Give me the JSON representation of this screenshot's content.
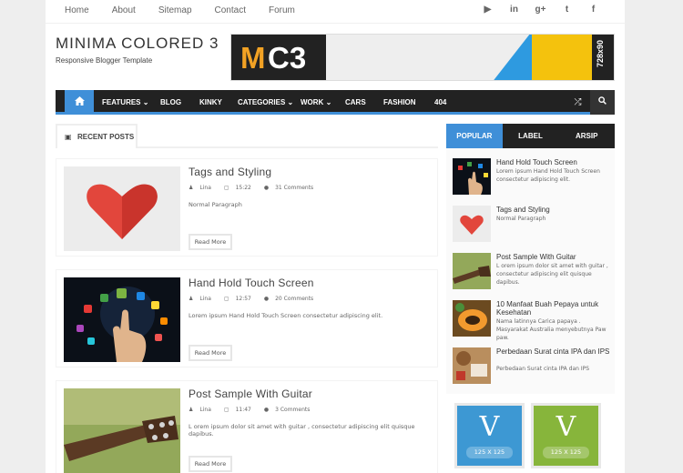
{
  "topnav": {
    "links": [
      "Home",
      "About",
      "Sitemap",
      "Contact",
      "Forum"
    ]
  },
  "social": {
    "icons": [
      "youtube-icon",
      "linkedin-icon",
      "googleplus-icon",
      "twitter-icon",
      "facebook-icon"
    ],
    "glyphs": [
      "▶",
      "in",
      "g+",
      "t",
      "f"
    ]
  },
  "header": {
    "title": "MINIMA COLORED 3",
    "description": "Responsive Blogger Template"
  },
  "banner": {
    "logo_m": "M",
    "logo_c3": "C3",
    "size_text": "728x90"
  },
  "nav": {
    "items": [
      "FEATURES",
      "BLOG",
      "KINKY",
      "CATEGORIES",
      "WORK",
      "CARS",
      "FASHION",
      "404"
    ],
    "has_dropdown": [
      true,
      false,
      false,
      true,
      true,
      false,
      false,
      false
    ]
  },
  "recent": {
    "label": "RECENT POSTS"
  },
  "posts": [
    {
      "title": "Tags and Styling",
      "author": "Lina",
      "time": "15:22",
      "comments": "31 Comments",
      "snippet": "Normal Paragraph",
      "read_more": "Read More"
    },
    {
      "title": "Hand Hold Touch Screen",
      "author": "Lina",
      "time": "12:57",
      "comments": "20 Comments",
      "snippet": "Lorem ipsum Hand Hold Touch Screen consectetur adipiscing elit.",
      "read_more": "Read More"
    },
    {
      "title": "Post Sample With Guitar",
      "author": "Lina",
      "time": "11:47",
      "comments": "3 Comments",
      "snippet": "L orem ipsum dolor sit amet with guitar , consectetur adipiscing elit quisque dapibus.",
      "read_more": "Read More"
    }
  ],
  "sidebar": {
    "tabs": [
      "POPULAR",
      "LABEL",
      "ARSIP"
    ],
    "active_tab": "POPULAR",
    "items": [
      {
        "title": "Hand Hold Touch Screen",
        "text": "Lorem ipsum Hand Hold Touch Screen consectetur adipiscing elit."
      },
      {
        "title": "Tags and Styling",
        "text": "Normal Paragraph"
      },
      {
        "title": "Post Sample With Guitar",
        "text": "L orem ipsum dolor sit amet with guitar , consectetur adipiscing elit quisque dapibus."
      },
      {
        "title": "10 Manfaat Buah Pepaya untuk Kesehatan",
        "text": "Nama latinnya Carica papaya . Masyarakat Australia menyebutnya Paw paw."
      },
      {
        "title": "Perbedaan Surat cinta IPA dan IPS",
        "text": "Perbedaan Surat cinta IPA dan IPS"
      }
    ]
  },
  "ads": [
    {
      "letter": "V",
      "size": "125 X 125",
      "color": "#3d98d3"
    },
    {
      "letter": "V",
      "size": "125 X 125",
      "color": "#87b53b"
    }
  ],
  "colors": {
    "accent": "#3f8fd8",
    "nav_bg": "#222222",
    "heart": "#e2463c"
  }
}
